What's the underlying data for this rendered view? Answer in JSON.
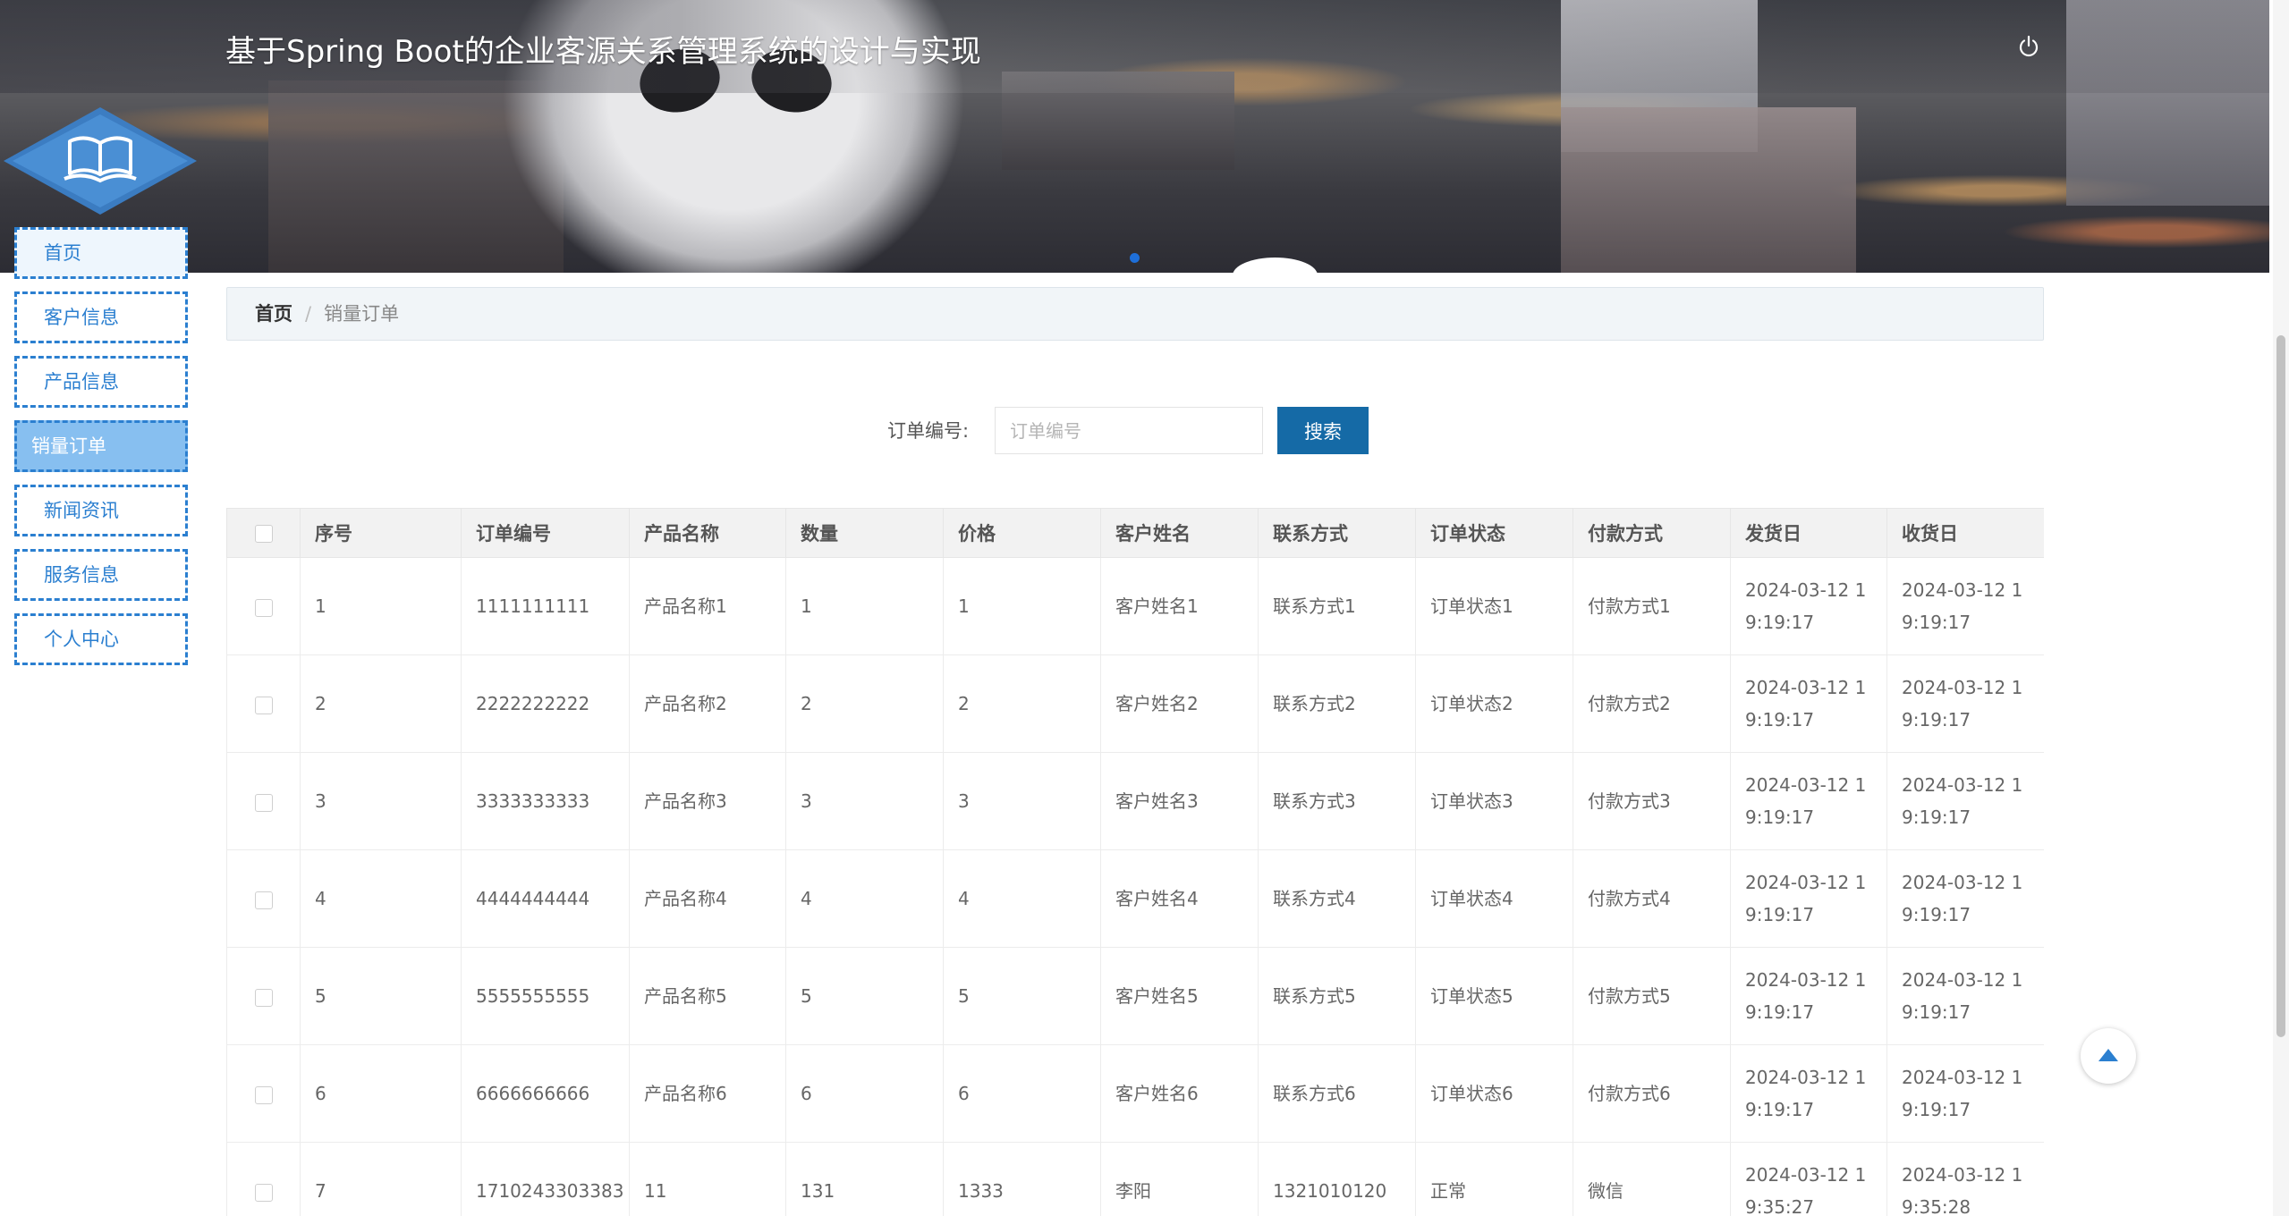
{
  "header": {
    "title": "基于Spring Boot的企业客源关系管理系统的设计与实现"
  },
  "sidebar": {
    "items": [
      {
        "label": "首页"
      },
      {
        "label": "客户信息"
      },
      {
        "label": "产品信息"
      },
      {
        "label": "销量订单"
      },
      {
        "label": "新闻资讯"
      },
      {
        "label": "服务信息"
      },
      {
        "label": "个人中心"
      }
    ],
    "active_index": 3
  },
  "breadcrumb": {
    "home": "首页",
    "separator": "/",
    "current": "销量订单"
  },
  "search": {
    "label": "订单编号:",
    "placeholder": "订单编号",
    "value": "",
    "button_label": "搜索"
  },
  "table": {
    "columns": [
      "序号",
      "订单编号",
      "产品名称",
      "数量",
      "价格",
      "客户姓名",
      "联系方式",
      "订单状态",
      "付款方式",
      "发货日",
      "收货日"
    ],
    "rows": [
      [
        "1",
        "1111111111",
        "产品名称1",
        "1",
        "1",
        "客户姓名1",
        "联系方式1",
        "订单状态1",
        "付款方式1",
        "2024-03-12 19:19:17",
        "2024-03-12 19:19:17"
      ],
      [
        "2",
        "2222222222",
        "产品名称2",
        "2",
        "2",
        "客户姓名2",
        "联系方式2",
        "订单状态2",
        "付款方式2",
        "2024-03-12 19:19:17",
        "2024-03-12 19:19:17"
      ],
      [
        "3",
        "3333333333",
        "产品名称3",
        "3",
        "3",
        "客户姓名3",
        "联系方式3",
        "订单状态3",
        "付款方式3",
        "2024-03-12 19:19:17",
        "2024-03-12 19:19:17"
      ],
      [
        "4",
        "4444444444",
        "产品名称4",
        "4",
        "4",
        "客户姓名4",
        "联系方式4",
        "订单状态4",
        "付款方式4",
        "2024-03-12 19:19:17",
        "2024-03-12 19:19:17"
      ],
      [
        "5",
        "5555555555",
        "产品名称5",
        "5",
        "5",
        "客户姓名5",
        "联系方式5",
        "订单状态5",
        "付款方式5",
        "2024-03-12 19:19:17",
        "2024-03-12 19:19:17"
      ],
      [
        "6",
        "6666666666",
        "产品名称6",
        "6",
        "6",
        "客户姓名6",
        "联系方式6",
        "订单状态6",
        "付款方式6",
        "2024-03-12 19:19:17",
        "2024-03-12 19:19:17"
      ],
      [
        "7",
        "1710243303383",
        "11",
        "131",
        "1333",
        "李阳",
        "1321010120",
        "正常",
        "微信",
        "2024-03-12 19:35:27",
        "2024-03-12 19:35:28"
      ]
    ]
  },
  "icons": {
    "power": "power-icon",
    "logo": "open-book-icon",
    "back_to_top": "arrow-up-icon"
  },
  "colors": {
    "accent": "#2b7fd0",
    "active_nav": "#87bff0",
    "search_button": "#156aa6",
    "carousel_dot": "#1e6fd9"
  }
}
